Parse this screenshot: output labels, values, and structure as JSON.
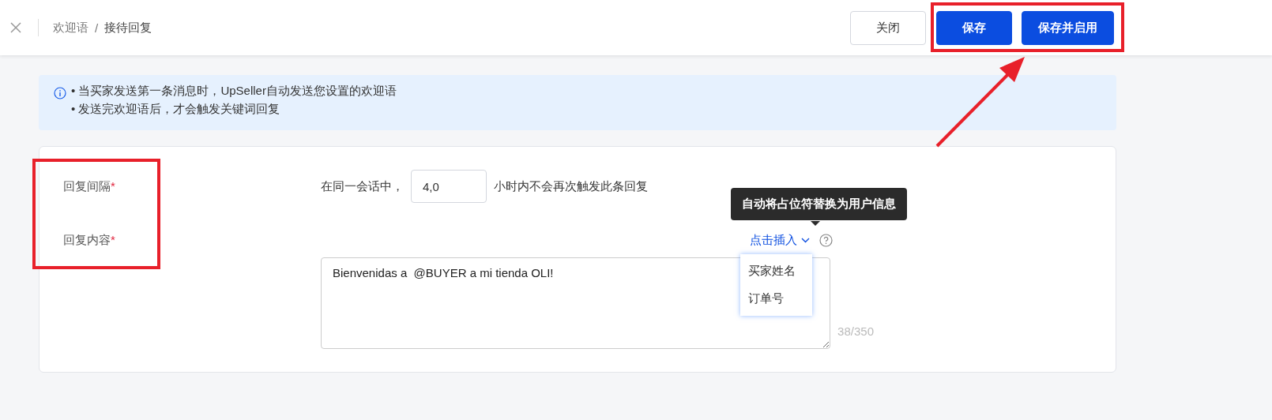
{
  "header": {
    "breadcrumb": [
      "欢迎语",
      "接待回复"
    ],
    "separator": "/",
    "buttons": [
      {
        "label": "关闭",
        "kind": "default"
      },
      {
        "label": "保存",
        "kind": "primary"
      },
      {
        "label": "保存并启用",
        "kind": "primary"
      }
    ]
  },
  "notice": {
    "lines": [
      "• 当买家发送第一条消息时，UpSeller自动发送您设置的欢迎语",
      "• 发送完欢迎语后，才会触发关键词回复"
    ]
  },
  "form": {
    "fields": [
      {
        "label": "回复间隔",
        "required_mark": "*"
      },
      {
        "label": "回复内容",
        "required_mark": "*"
      }
    ],
    "interval": {
      "prefix": "在同一会话中，",
      "value": "4,0",
      "suffix": "小时内不会再次触发此条回复"
    },
    "insert": {
      "label": "点击插入",
      "tooltip": "自动将占位符替换为用户信息",
      "options": [
        "买家姓名",
        "订单号"
      ]
    },
    "content": {
      "value": "Bienvenidas a  @BUYER a mi tienda OLI!",
      "counter": "38/350"
    }
  },
  "annotations": [
    {
      "kind": "box"
    },
    {
      "kind": "box"
    },
    {
      "kind": "arrow"
    }
  ]
}
